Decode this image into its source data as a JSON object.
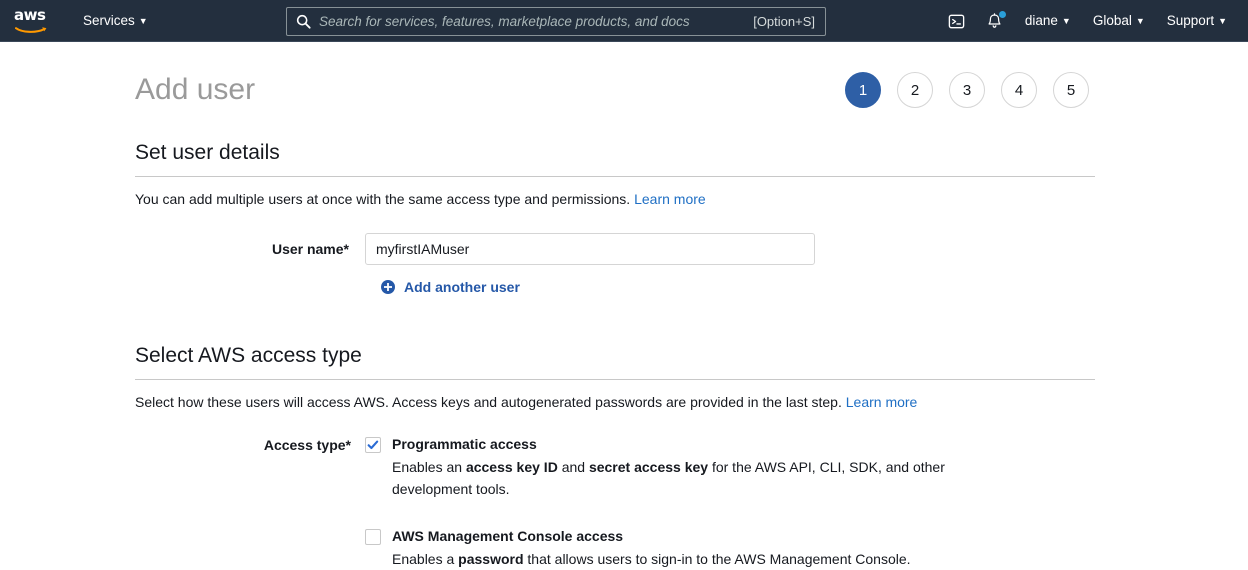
{
  "navbar": {
    "logo_alt": "aws",
    "services_label": "Services",
    "caret": "▼",
    "search": {
      "placeholder": "Search for services, features, marketplace products, and docs",
      "value": "",
      "shortcut": "[Option+S]"
    },
    "cloudshell_icon": "cloudshell-icon",
    "notifications_icon": "bell-icon",
    "account_label": "diane",
    "region_label": "Global",
    "support_label": "Support"
  },
  "page": {
    "title": "Add user",
    "steps": [
      {
        "number": "1",
        "active": true
      },
      {
        "number": "2",
        "active": false
      },
      {
        "number": "3",
        "active": false
      },
      {
        "number": "4",
        "active": false
      },
      {
        "number": "5",
        "active": false
      }
    ]
  },
  "user_details": {
    "section_title": "Set user details",
    "description": "You can add multiple users at once with the same access type and permissions.",
    "learn_more": "Learn more",
    "username_label": "User name*",
    "username_value": "myfirstIAMuser",
    "username_placeholder": "",
    "add_another_label": "Add another user"
  },
  "access_type": {
    "section_title": "Select AWS access type",
    "description": "Select how these users will access AWS. Access keys and autogenerated passwords are provided in the last step.",
    "learn_more": "Learn more",
    "label": "Access type*",
    "options": [
      {
        "title": "Programmatic access",
        "checked": true,
        "desc_parts": [
          {
            "text": "Enables an ",
            "bold": false
          },
          {
            "text": "access key ID",
            "bold": true
          },
          {
            "text": " and ",
            "bold": false
          },
          {
            "text": "secret access key",
            "bold": true
          },
          {
            "text": " for the AWS API, CLI, SDK, and other development tools.",
            "bold": false
          }
        ]
      },
      {
        "title": "AWS Management Console access",
        "checked": false,
        "desc_parts": [
          {
            "text": "Enables a ",
            "bold": false
          },
          {
            "text": "password",
            "bold": true
          },
          {
            "text": " that allows users to sign-in to the AWS Management Console.",
            "bold": false
          }
        ]
      }
    ]
  },
  "colors": {
    "nav_background": "#232f3e",
    "accent_blue": "#2e5fa6",
    "link_blue": "#1f6fc4",
    "logo_orange": "#ff9900",
    "notification_dot": "#2a9fd8"
  }
}
